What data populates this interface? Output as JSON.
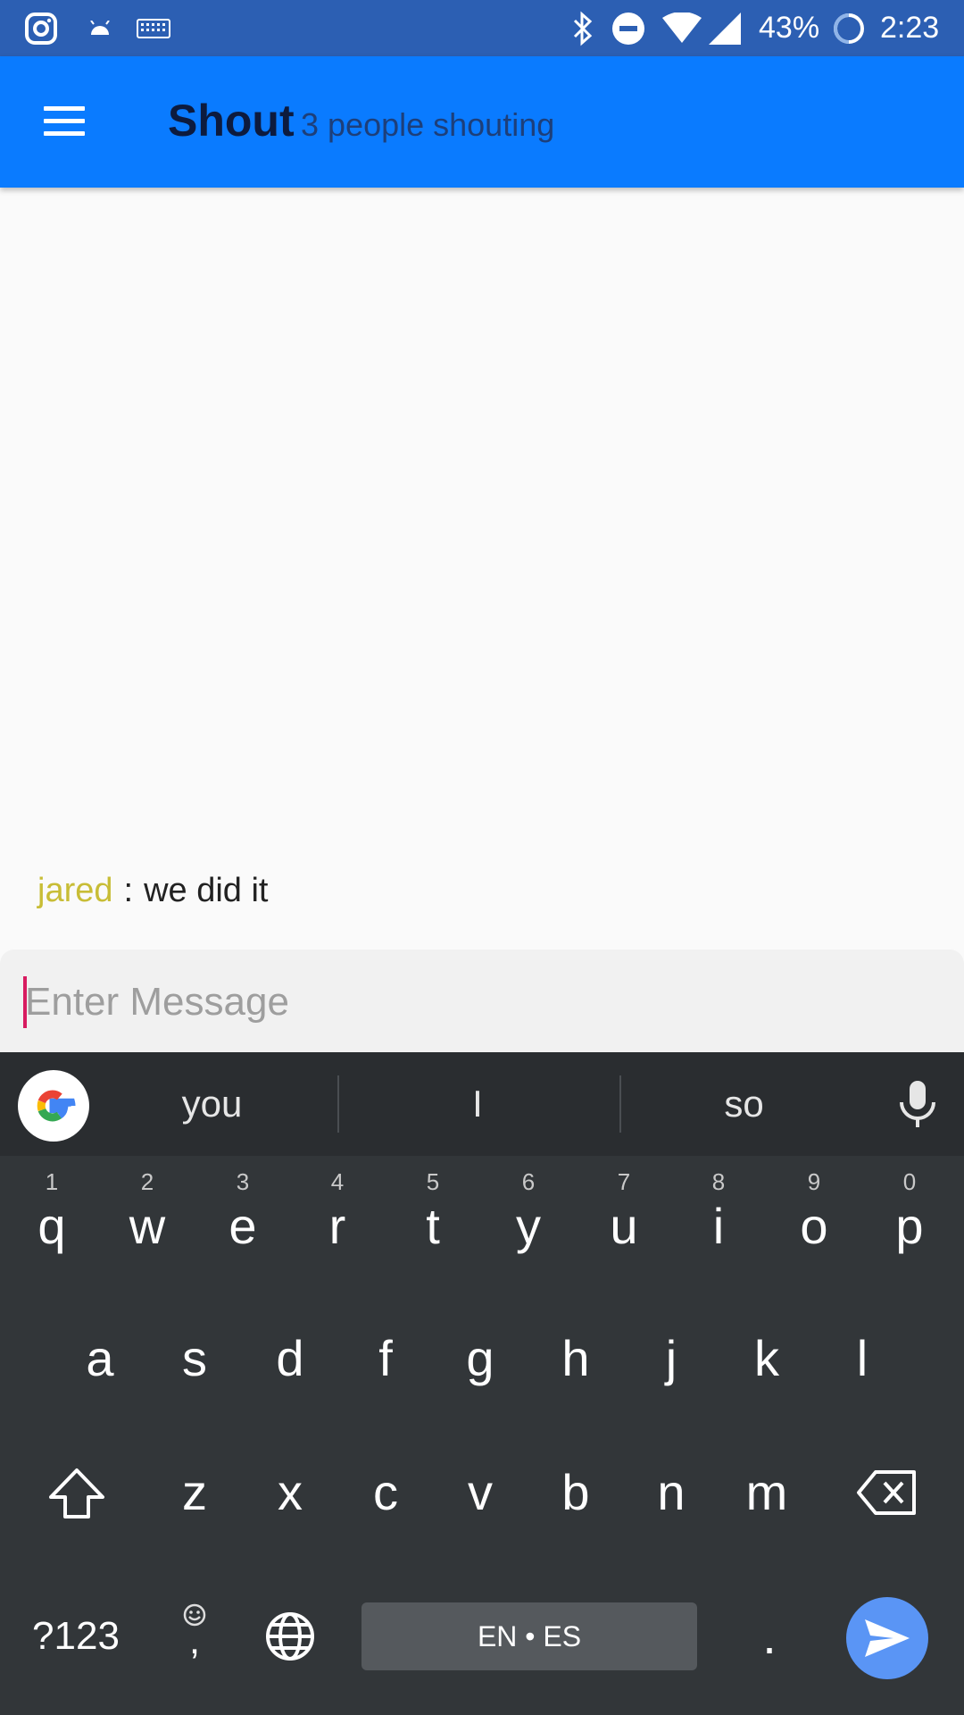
{
  "status_bar": {
    "icons": [
      "instagram-icon",
      "android-icon",
      "keyboard-icon",
      "bluetooth-icon",
      "do-not-disturb-icon",
      "wifi-icon",
      "cell-signal-icon",
      "battery-icon"
    ],
    "battery": "43%",
    "time": "2:23"
  },
  "app_bar": {
    "title": "Shout",
    "subtitle": "3 people shouting",
    "color": "#0a7bff"
  },
  "messages": [
    {
      "user": "jared",
      "separator": ":",
      "text": "we did it",
      "user_color": "#c8bd36"
    }
  ],
  "composer": {
    "placeholder": "Enter Message",
    "cursor_color": "#d81b60"
  },
  "keyboard": {
    "suggestions": [
      "you",
      "I",
      "so"
    ],
    "row1": [
      {
        "key": "q",
        "hint": "1"
      },
      {
        "key": "w",
        "hint": "2"
      },
      {
        "key": "e",
        "hint": "3"
      },
      {
        "key": "r",
        "hint": "4"
      },
      {
        "key": "t",
        "hint": "5"
      },
      {
        "key": "y",
        "hint": "6"
      },
      {
        "key": "u",
        "hint": "7"
      },
      {
        "key": "i",
        "hint": "8"
      },
      {
        "key": "o",
        "hint": "9"
      },
      {
        "key": "p",
        "hint": "0"
      }
    ],
    "row2": [
      "a",
      "s",
      "d",
      "f",
      "g",
      "h",
      "j",
      "k",
      "l"
    ],
    "row3": [
      "z",
      "x",
      "c",
      "v",
      "b",
      "n",
      "m"
    ],
    "symbols_label": "?123",
    "comma": ",",
    "space_label": "EN • ES",
    "period": "."
  }
}
